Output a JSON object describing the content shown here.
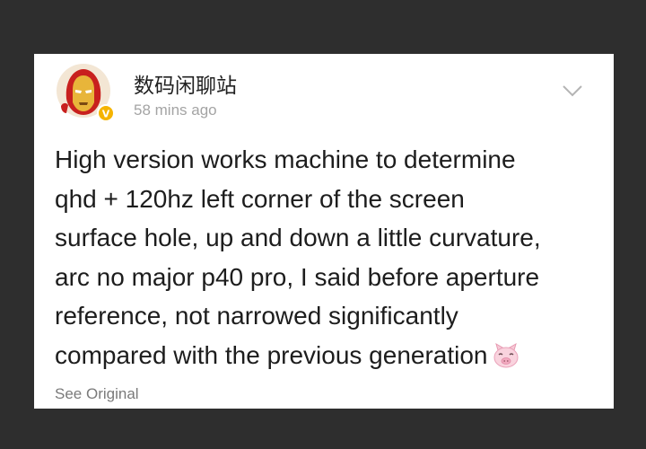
{
  "post": {
    "author": "数码闲聊站",
    "timestamp": "58  mins ago",
    "lines": [
      "High version works machine to determine",
      "qhd + 120hz left corner of the screen",
      "surface hole, up and down a little curvature,",
      "arc no major p40 pro, I said before aperture",
      "reference, not narrowed significantly",
      "compared with the previous generation"
    ],
    "emoji": "pig-face-emoji",
    "see_original_label": "See Original"
  },
  "icons": {
    "avatar": "iron-man-avatar",
    "verified": "verified-badge-icon",
    "expand": "chevron-down-icon"
  },
  "colors": {
    "background": "#2e2e2e",
    "card": "#ffffff",
    "text": "#1d1d1d",
    "meta": "#a4a4a4",
    "verified_badge": "#f5b400"
  }
}
